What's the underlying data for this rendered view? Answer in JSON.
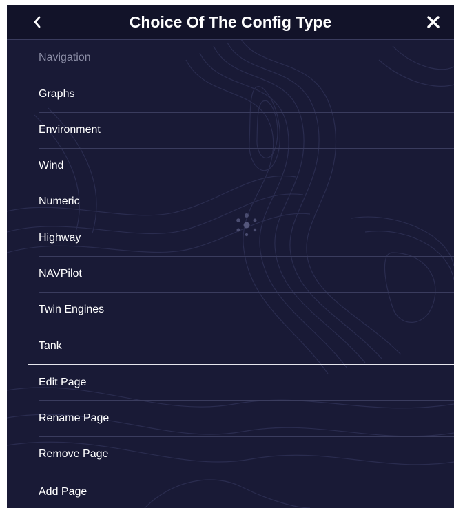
{
  "header": {
    "title": "Choice Of The Config Type",
    "back_icon": "chevron-left-icon",
    "close_icon": "close-icon"
  },
  "config_types": [
    {
      "label": "Navigation",
      "enabled": false
    },
    {
      "label": "Graphs",
      "enabled": true
    },
    {
      "label": "Environment",
      "enabled": true
    },
    {
      "label": "Wind",
      "enabled": true
    },
    {
      "label": "Numeric",
      "enabled": true
    },
    {
      "label": "Highway",
      "enabled": true
    },
    {
      "label": "NAVPilot",
      "enabled": true
    },
    {
      "label": "Twin Engines",
      "enabled": true
    },
    {
      "label": "Tank",
      "enabled": true
    }
  ],
  "page_actions": [
    {
      "label": "Edit Page"
    },
    {
      "label": "Rename Page"
    },
    {
      "label": "Remove Page"
    }
  ],
  "add_action": {
    "label": "Add Page"
  },
  "colors": {
    "background": "#191a36",
    "header": "#121329",
    "text": "#ffffff",
    "disabled_text": "#8c8ea6",
    "divider": "#3a3c5e",
    "section_divider": "#e6e6ee"
  }
}
